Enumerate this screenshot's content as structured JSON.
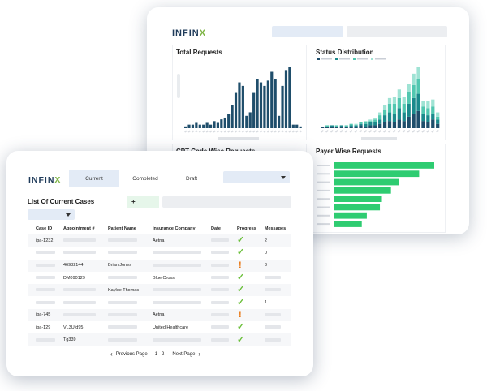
{
  "dashboard": {
    "logo_main": "INFIN",
    "logo_accent": "X",
    "panels": {
      "total_requests": "Total Requests",
      "status_distribution": "Status Distribution",
      "cpt_code": "CPT Code Wise Requests",
      "payer_wise": "Payer Wise Requests"
    }
  },
  "cases": {
    "logo_main": "INFIN",
    "logo_accent": "X",
    "tabs": [
      {
        "label": "Current",
        "active": true
      },
      {
        "label": "Completed",
        "active": false
      },
      {
        "label": "Draft",
        "active": false
      }
    ],
    "title": "List Of Current Cases",
    "add_label": "+",
    "columns": [
      "Case ID",
      "Appointment #",
      "Patient Name",
      "Insurance Company",
      "Date",
      "Progress",
      "Messages"
    ],
    "rows": [
      {
        "case_id": "ipa-1232",
        "appointment": "",
        "patient": "",
        "insurance": "Aetna",
        "date": "",
        "progress": "done",
        "messages": "2"
      },
      {
        "case_id": "",
        "appointment": "",
        "patient": "",
        "insurance": "",
        "date": "",
        "progress": "done",
        "messages": "0"
      },
      {
        "case_id": "",
        "appointment": "46982144",
        "patient": "Brian Jones",
        "insurance": "",
        "date": "",
        "progress": "alert",
        "messages": "3"
      },
      {
        "case_id": "",
        "appointment": "DM090129",
        "patient": "",
        "insurance": "Blue Cross",
        "date": "",
        "progress": "done",
        "messages": ""
      },
      {
        "case_id": "",
        "appointment": "",
        "patient": "Kaylee Thomas",
        "insurance": "",
        "date": "",
        "progress": "done",
        "messages": ""
      },
      {
        "case_id": "",
        "appointment": "",
        "patient": "",
        "insurance": "",
        "date": "",
        "progress": "done",
        "messages": "1"
      },
      {
        "case_id": "ipa-745",
        "appointment": "",
        "patient": "",
        "insurance": "Aetna",
        "date": "",
        "progress": "alert",
        "messages": ""
      },
      {
        "case_id": "ipa-129",
        "appointment": "VL3Ufd95",
        "patient": "",
        "insurance": "United Healthcare",
        "date": "",
        "progress": "done",
        "messages": ""
      },
      {
        "case_id": "",
        "appointment": "Tg339",
        "patient": "",
        "insurance": "",
        "date": "",
        "progress": "done",
        "messages": ""
      }
    ],
    "pager": {
      "prev_label": "Previous Page",
      "pages": [
        "1",
        "2"
      ],
      "next_label": "Next Page"
    }
  },
  "colors": {
    "navy": "#1f4e6b",
    "teal_dark": "#2e8b7f",
    "teal_light": "#9fe3d4",
    "green": "#2ecc71",
    "check": "#6abf3a",
    "alert": "#e8730c"
  },
  "chart_data": [
    {
      "type": "bar",
      "title": "Total Requests",
      "values": [
        1,
        2,
        2,
        3,
        2,
        2,
        3,
        2,
        4,
        3,
        5,
        6,
        8,
        13,
        20,
        26,
        24,
        7,
        9,
        20,
        28,
        26,
        24,
        27,
        32,
        28,
        7,
        24,
        33,
        35,
        2,
        2,
        1
      ]
    },
    {
      "type": "bar",
      "title": "Status Distribution",
      "stacked": true,
      "series": [
        {
          "values": [
            1,
            1,
            1,
            1,
            1,
            1,
            1,
            1,
            2,
            1,
            2,
            2,
            3,
            4,
            5,
            4,
            6,
            5,
            8,
            10,
            12,
            5,
            4,
            6,
            3
          ]
        },
        {
          "values": [
            0,
            0,
            1,
            0,
            1,
            0,
            1,
            1,
            1,
            2,
            2,
            2,
            3,
            5,
            6,
            6,
            8,
            6,
            9,
            11,
            12,
            5,
            5,
            4,
            3
          ]
        },
        {
          "values": [
            0,
            1,
            0,
            1,
            0,
            1,
            1,
            0,
            1,
            1,
            1,
            2,
            3,
            4,
            6,
            7,
            7,
            6,
            8,
            9,
            10,
            5,
            5,
            5,
            2
          ]
        },
        {
          "values": [
            0,
            0,
            0,
            0,
            0,
            0,
            0,
            1,
            0,
            1,
            1,
            1,
            2,
            3,
            4,
            5,
            6,
            5,
            6,
            8,
            9,
            4,
            5,
            5,
            3
          ]
        }
      ]
    },
    {
      "type": "bar",
      "orientation": "horizontal",
      "title": "Payer Wise Requests",
      "values": [
        100,
        85,
        65,
        57,
        48,
        46,
        33,
        28
      ]
    }
  ]
}
